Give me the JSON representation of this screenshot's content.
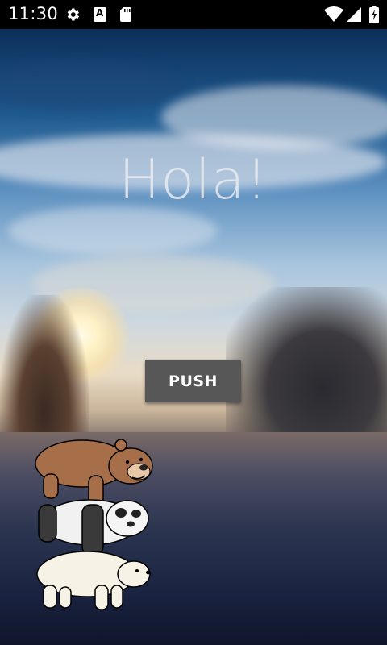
{
  "status_bar": {
    "time": "11:30",
    "icons": [
      "gear-icon",
      "font-icon",
      "sd-card-icon",
      "wifi-icon",
      "signal-icon",
      "battery-icon"
    ],
    "font_icon_glyph": "A"
  },
  "main": {
    "greeting": "Hola!",
    "push_button_label": "PUSH"
  },
  "colors": {
    "status_bar_bg": "#000000",
    "button_bg": "#575757",
    "greeting_text": "#ebeef2"
  }
}
